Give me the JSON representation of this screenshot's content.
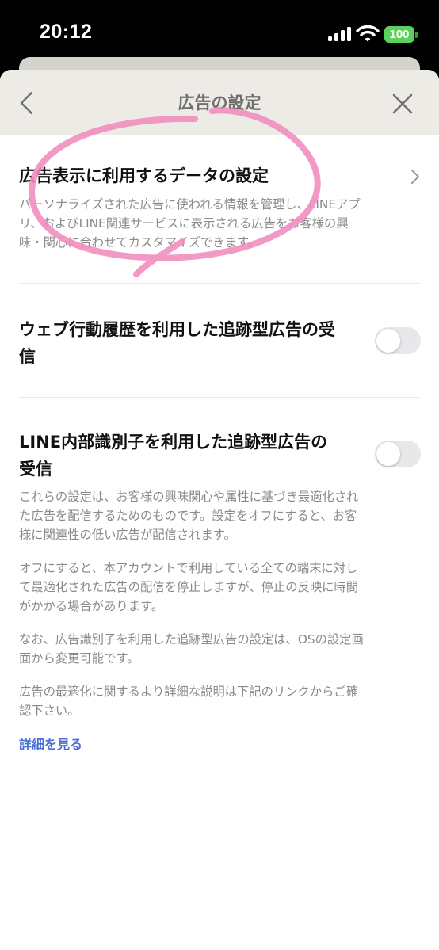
{
  "status_bar": {
    "time": "20:12",
    "battery": "100",
    "battery_color": "#5bd15c"
  },
  "header": {
    "title": "広告の設定",
    "back_icon": "chevron-left-icon",
    "close_icon": "close-icon"
  },
  "settings": [
    {
      "title": "広告表示に利用するデータの設定",
      "description": [
        "パーソナライズされた広告に使われる情報を管理し、LINEアプ",
        "リ、およびLINE関連サービスに表示される広告をお客様の興",
        "味・関心に合わせてカスタマイズできます。"
      ],
      "control": "chevron-right-icon"
    },
    {
      "title": [
        "ウェブ行動履歴を利用した追跡型広告の受",
        "信"
      ],
      "toggle": false
    },
    {
      "title": [
        "LINE内部識別子を利用した追跡型広告の",
        "受信"
      ],
      "toggle": false,
      "description_paragraphs": [
        [
          "これらの設定は、お客様の興味関心や属性に基づき最適化され",
          "た広告を配信するためのものです。設定をオフにすると、お客",
          "様に関連性の低い広告が配信されます。"
        ],
        [
          "オフにすると、本アカウントで利用している全ての端末に対し",
          "て最適化された広告の配信を停止しますが、停止の反映に時間",
          "がかかる場合があります。"
        ],
        [
          "なお、広告識別子を利用した追跡型広告の設定は、OSの設定画",
          "面から変更可能です。"
        ],
        [
          "広告の最適化に関するより詳細な説明は下記のリンクからご確",
          "認下さい。"
        ]
      ]
    }
  ],
  "link": {
    "label": "詳細を見る",
    "color": "#4a6fd7"
  },
  "annotation": {
    "color": "#f08bbd"
  }
}
